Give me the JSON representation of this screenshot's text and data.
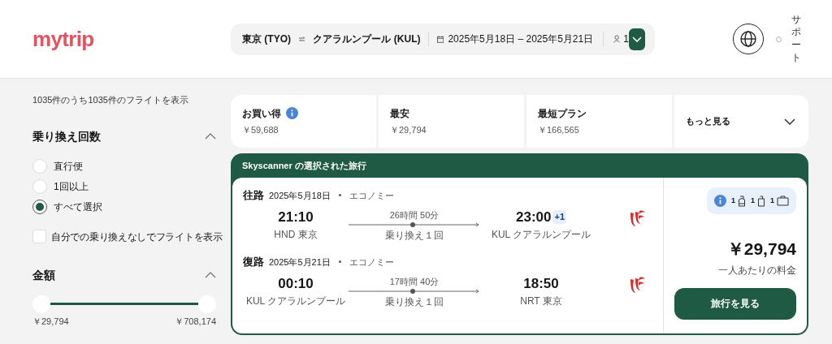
{
  "header": {
    "logo": "mytrip",
    "search": {
      "origin": "東京 (TYO)",
      "destination": "クアラルンプール (KUL)",
      "dates": "2025年5月18日 – 2025年5月21日",
      "travelers": "1"
    },
    "support": "サポート"
  },
  "sidebar": {
    "result_count": "1035件のうち1035件のフライトを表示",
    "stops_filter": {
      "title": "乗り換え回数",
      "expanded": true,
      "options": [
        {
          "label": "直行便",
          "selected": false
        },
        {
          "label": "1回以上",
          "selected": false
        },
        {
          "label": "すべて選択",
          "selected": true
        }
      ]
    },
    "self_transfer": {
      "label": "自分での乗り換えなしでフライトを表示",
      "checked": false
    },
    "price_filter": {
      "title": "金額",
      "expanded": true,
      "thumbs": [
        {
          "level": 0
        },
        {
          "level": 1
        }
      ],
      "min": "￥29,794",
      "max": "￥708,174"
    }
  },
  "sort_tabs": [
    {
      "label": "お買い得",
      "price": "￥59,688",
      "info": true,
      "selected": false
    },
    {
      "label": "最安",
      "price": "￥29,794",
      "info": false,
      "selected": false
    },
    {
      "label": "最短プラン",
      "price": "￥166,565",
      "info": false,
      "selected": false
    }
  ],
  "more_button": "もっと見る",
  "result": {
    "banner": "Skyscanner の選択された旅行",
    "legs": [
      {
        "direction": "往路",
        "date": "2025年5月18日",
        "cabin": "エコノミー",
        "depart_time": "21:10",
        "depart_airport": "HND 東京",
        "duration": "26時間 50分",
        "stops": "乗り換え１回",
        "arrive_time": "23:00",
        "day_offset": "+1",
        "arrive_airport": "KUL クアラルンプール"
      },
      {
        "direction": "復路",
        "date": "2025年5月21日",
        "cabin": "エコノミー",
        "depart_time": "00:10",
        "depart_airport": "KUL クアラルンプール",
        "duration": "17時間 40分",
        "stops": "乗り換え１回",
        "arrive_time": "18:50",
        "arrive_airport": "NRT 東京"
      }
    ],
    "baggage": [
      {
        "kind": "personal",
        "count": "1"
      },
      {
        "kind": "carry_on",
        "count": "1"
      },
      {
        "kind": "checked",
        "count": "1"
      }
    ],
    "price": "￥29,794",
    "price_note": "一人あたりの料金",
    "button": "旅行を見る"
  }
}
